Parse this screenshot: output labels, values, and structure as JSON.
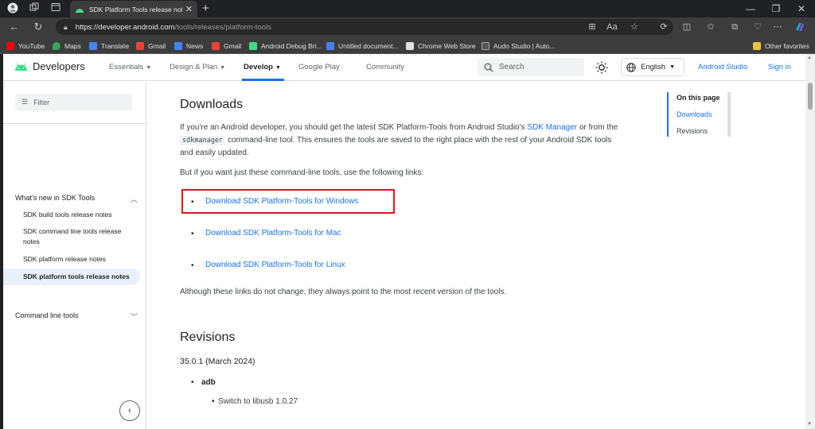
{
  "browser": {
    "tab_title": "SDK Platform Tools release notes",
    "url_domain": "https://developer.android.com",
    "url_path": "/tools/releases/platform-tools",
    "bookmarks": [
      "YouTube",
      "Maps",
      "Translate",
      "Gmail",
      "News",
      "Gmail",
      "Android Debug Bri...",
      "Untitled document...",
      "Chrome Web Store",
      "Audo Studio | Auto..."
    ],
    "other_favorites": "Other favorites"
  },
  "site": {
    "logo": "Developers",
    "nav": [
      "Essentials",
      "Design & Plan",
      "Develop",
      "Google Play",
      "Community"
    ],
    "search_placeholder": "Search",
    "language": "English",
    "android_studio": "Android Studio",
    "sign_in": "Sign in"
  },
  "sidebar": {
    "filter_placeholder": "Filter",
    "group1": "What's new in SDK Tools",
    "items": [
      "SDK build tools release notes",
      "SDK command line tools release notes",
      "SDK platform release notes",
      "SDK platform tools release notes"
    ],
    "group2": "Command line tools"
  },
  "content": {
    "downloads_heading": "Downloads",
    "intro_1": "If you're an Android developer, you should get the latest SDK Platform-Tools from Android Studio's ",
    "intro_link": "SDK Manager",
    "intro_2": " or from the ",
    "intro_code": "sdkmanager",
    "intro_3": " command-line tool. This ensures the tools are saved to the right place with the rest of your Android SDK tools and easily updated.",
    "links_intro": "But if you want just these command-line tools, use the following links:",
    "download_links": [
      "Download SDK Platform-Tools for Windows",
      "Download SDK Platform-Tools for Mac",
      "Download SDK Platform-Tools for Linux"
    ],
    "note": "Although these links do not change, they always point to the most recent version of the tools.",
    "revisions_heading": "Revisions",
    "version": "35.0.1 (March 2024)",
    "sub_heading": "adb",
    "sub_item": "Switch to libusb 1.0.27"
  },
  "toc": {
    "title": "On this page",
    "items": [
      "Downloads",
      "Revisions"
    ]
  },
  "colors": {
    "link": "#1a73e8",
    "highlight": "#e3121b",
    "android_green": "#3ddc84"
  }
}
